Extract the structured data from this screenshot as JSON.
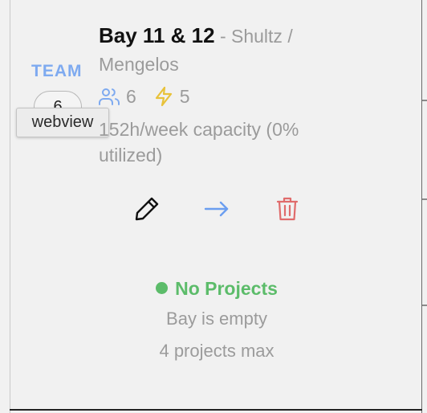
{
  "team": {
    "label": "TEAM",
    "count": "6",
    "tooltip": "webview"
  },
  "bay": {
    "name": "Bay 11 & 12",
    "owner_prefix": " - Shultz /",
    "owner_second": "Mengelos",
    "people_count": "6",
    "power_count": "5",
    "capacity_line1": "152h/week capacity (0%",
    "capacity_line2": "utilized)"
  },
  "actions": {
    "edit": "pencil-icon",
    "move": "arrow-right-icon",
    "delete": "trash-icon"
  },
  "status": {
    "label": "No Projects",
    "description": "Bay is empty",
    "limit": "4 projects max"
  },
  "colors": {
    "accent_blue": "#7eaaf0",
    "status_green": "#5cbc6a",
    "delete_red": "#e06b6b",
    "power_yellow": "#e8c23a",
    "muted_text": "#9b9b9b"
  }
}
